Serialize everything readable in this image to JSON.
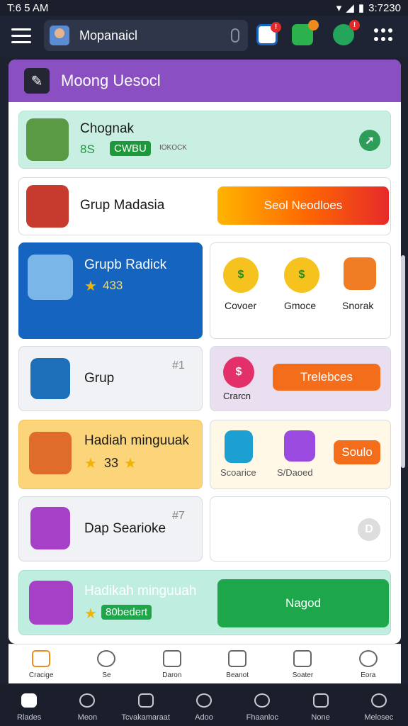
{
  "status_bar": {
    "time_left": "T:6 5 AM",
    "time_right": "3:7230"
  },
  "top_bar": {
    "search_text": "Mopanaicl"
  },
  "section": {
    "title": "Moong Uesocl"
  },
  "cards": {
    "c1": {
      "title": "Chognak",
      "score": "8S",
      "tag": "CWBU",
      "sub": "IOKOCK"
    },
    "c2": {
      "title": "Grup Madasia",
      "button": "Seol Neodloes"
    },
    "c3": {
      "title": "Grupb Radick",
      "stars": "433"
    },
    "c4": {
      "labels": [
        "Covoer",
        "Gmoce",
        "Snorak"
      ]
    },
    "c5": {
      "title": "Grup",
      "corner": "#1"
    },
    "c6": {
      "label": "Crarcn",
      "button": "Trelebces"
    },
    "c7": {
      "title": "Hadiah minguuak",
      "stars": "33"
    },
    "c8": {
      "labels": [
        "Scoarice",
        "S/Daoed"
      ],
      "button": "Soulo"
    },
    "c9": {
      "title": "Dap Searioke",
      "corner": "#7"
    },
    "c11": {
      "title": "Hadikah minguuah",
      "badge": "80bedert",
      "button": "Nagod"
    }
  },
  "bottom_nav_top": [
    "Cracige",
    "Se",
    "Daron",
    "Beanot",
    "Soater",
    "Eora"
  ],
  "bottom_nav": [
    "Rlades",
    "Meon",
    "Tcvakamaraat",
    "Adoo",
    "Fhaanloc",
    "None",
    "Melosec"
  ],
  "colors": {
    "accent": "#8a4fc0",
    "green": "#1ea64a",
    "blue": "#1565c0",
    "orange": "#f46d1b"
  }
}
